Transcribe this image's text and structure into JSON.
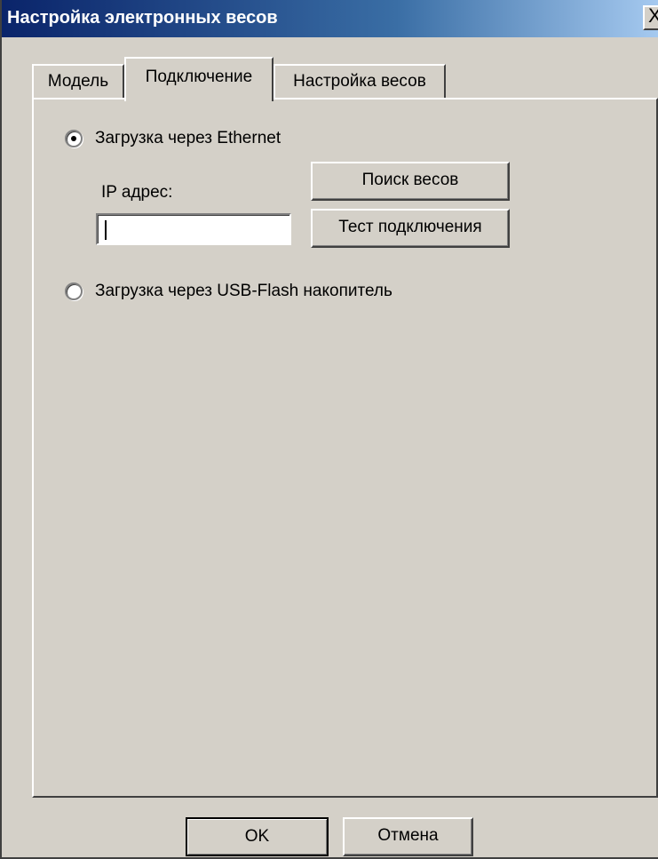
{
  "window": {
    "title": "Настройка электронных весов",
    "close_label": "X"
  },
  "tabs": [
    {
      "label": "Модель",
      "active": false
    },
    {
      "label": "Подключение",
      "active": true
    },
    {
      "label": "Настройка весов",
      "active": false
    }
  ],
  "connection": {
    "ethernet_option": {
      "label": "Загрузка через Ethernet",
      "checked": true
    },
    "ip_label": "IP адрес:",
    "ip_value": "",
    "search_button": "Поиск весов",
    "test_button": "Тест подключения",
    "usb_option": {
      "label": "Загрузка через USB-Flash накопитель",
      "checked": false
    }
  },
  "footer": {
    "ok_label": "OK",
    "cancel_label": "Отмена"
  }
}
